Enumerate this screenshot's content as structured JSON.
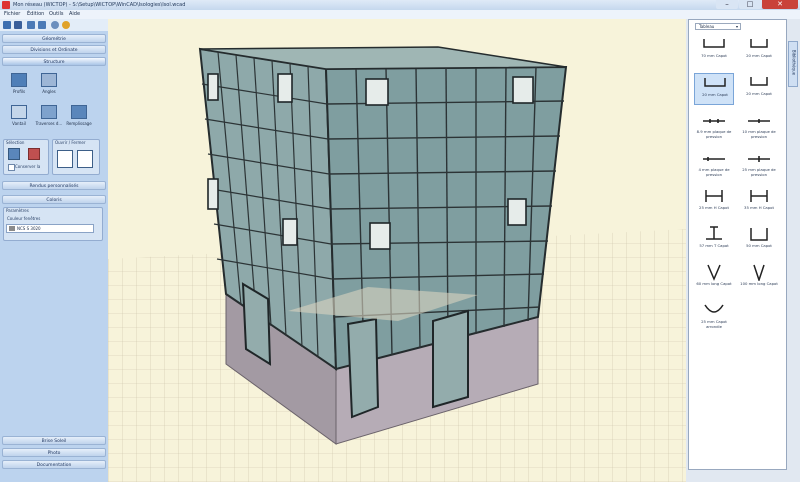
{
  "window": {
    "title": "Mon réseau (WICTOP) - S:\\Setup\\WICTOP\\WinCAD\\Isologies\\Isol.wcad",
    "minimize": "–",
    "maximize": "□",
    "close": "✕"
  },
  "menu": [
    "Fichier",
    "Édition",
    "Outils",
    "Aide"
  ],
  "toolbar_icons": [
    "new-file-icon",
    "save-icon",
    "undo-icon",
    "redo-icon",
    "settings-icon",
    "info-icon"
  ],
  "sidebar": {
    "sections_top": [
      "Géométrie",
      "Divisions et Ordinate",
      "Structure"
    ],
    "structure_tools": [
      {
        "label": "Profils",
        "icon": "profile-icon"
      },
      {
        "label": "Angles",
        "icon": "angle-icon"
      },
      {
        "label": "Vantail",
        "icon": "sash-icon"
      },
      {
        "label": "Traverses d…",
        "icon": "transom-icon"
      },
      {
        "label": "Remplissage",
        "icon": "infill-icon"
      }
    ],
    "selection_group": {
      "title": "Sélection",
      "checkbox": "Conserver la"
    },
    "opening_group": {
      "title": "Ouvrir / Fermer"
    },
    "sections_mid": [
      "Rendus personnalisés",
      "Coloris"
    ],
    "params_title": "Paramètres",
    "color_label": "Couleur fenêtres",
    "color_value": "NCS S 3020",
    "color_swatch": "#8a8a8a",
    "sections_bottom": [
      "Brise Soleil",
      "Photo",
      "Documentation"
    ]
  },
  "library": {
    "tab": "Bibliothèque",
    "filter": "Tableau",
    "items": [
      {
        "label": "70 mm Capot"
      },
      {
        "label": "20 mm Capot"
      },
      {
        "label": "20 mm Capot"
      },
      {
        "label": "20 mm Capot"
      },
      {
        "label": "8.9 mm plaque de pression"
      },
      {
        "label": "10 mm plaque de pression"
      },
      {
        "label": "4 mm plaque de pression"
      },
      {
        "label": "25 mm plaque de pression"
      },
      {
        "label": "25 mm H Capot"
      },
      {
        "label": "35 mm H Capot"
      },
      {
        "label": "57 mm T Capot"
      },
      {
        "label": "50 mm Capot"
      },
      {
        "label": "60 mm long Capot"
      },
      {
        "label": "100 mm long Capot"
      },
      {
        "label": "25 mm Capot arrondie"
      }
    ]
  },
  "colors": {
    "viewport_bg": "#f7f3da",
    "glass": "#7f9ea0",
    "frame": "#2c3436",
    "base": "#a39aa3",
    "panel": "#bcd3ee"
  }
}
